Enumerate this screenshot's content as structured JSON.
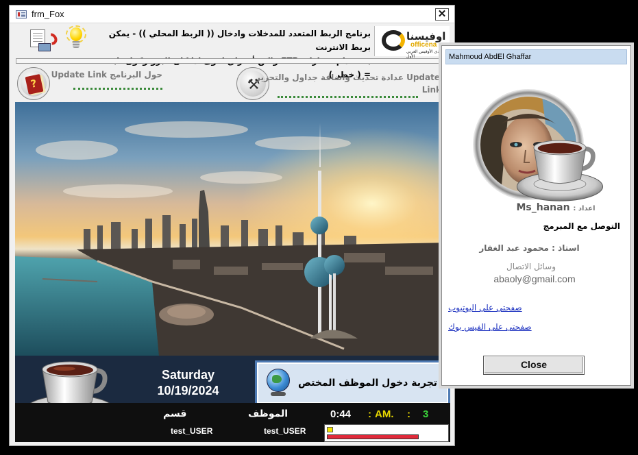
{
  "main_window": {
    "title": "frm_Fox",
    "close_glyph": "✕",
    "headline_line1": "برنامج الربط المتعدد للمدخلات وادخال (( الربط المحلي )) - يمكن بربط  الانترنت",
    "headline_line2": "بستخدام مسارات  FTP  ولكن أختراق اقوى اذا كان البروتوكول ثابت = ( خطر )",
    "logo_arabic": "اوفيسنا",
    "logo_latin": "officena",
    "logo_tagline": "منتدى الأوفيس العربي الأول",
    "icons": {
      "backup": "backup-restore-icon",
      "bulb": "lightbulb-icon",
      "about": "help-book-icon",
      "update": "tools-icon"
    }
  },
  "toolbar": {
    "about_label": "حول البرنامج Update Link",
    "update_label": "Update عدادة تحديث واضافة جداول والتحرير",
    "update_label2": "Link"
  },
  "bottom": {
    "day": "Saturday",
    "date": "10/19/2024",
    "login_button": "تجربة  دخول الموظف المختص",
    "dept_label": "قسم",
    "employee_label": "الموظف",
    "dept_value": "test_USER",
    "employee_value": "test_USER",
    "clock_time": "0:44",
    "clock_sep": ":",
    "clock_ampm": "AM.",
    "clock_seconds": "3",
    "colors": {
      "time": "#ffffff",
      "ampm": "#e8d800",
      "seconds": "#3bd43b",
      "progress": "#e02a3a"
    }
  },
  "about_window": {
    "title": "Mahmoud AbdEl Ghaffar",
    "prepared_by_label": "اعداد :",
    "prepared_by": "Ms_hanan",
    "contact_heading": "التوصل مع المبرمج",
    "teacher": "استاذ : محمود عبد الغفار",
    "contact_means": "وسائل الاتصال",
    "email": "abaoly@gmail.com",
    "youtube_link": "صفحتى على اليوتيوب",
    "facebook_link": "صفحتى على الفيس بوك",
    "close_button": "Close"
  }
}
